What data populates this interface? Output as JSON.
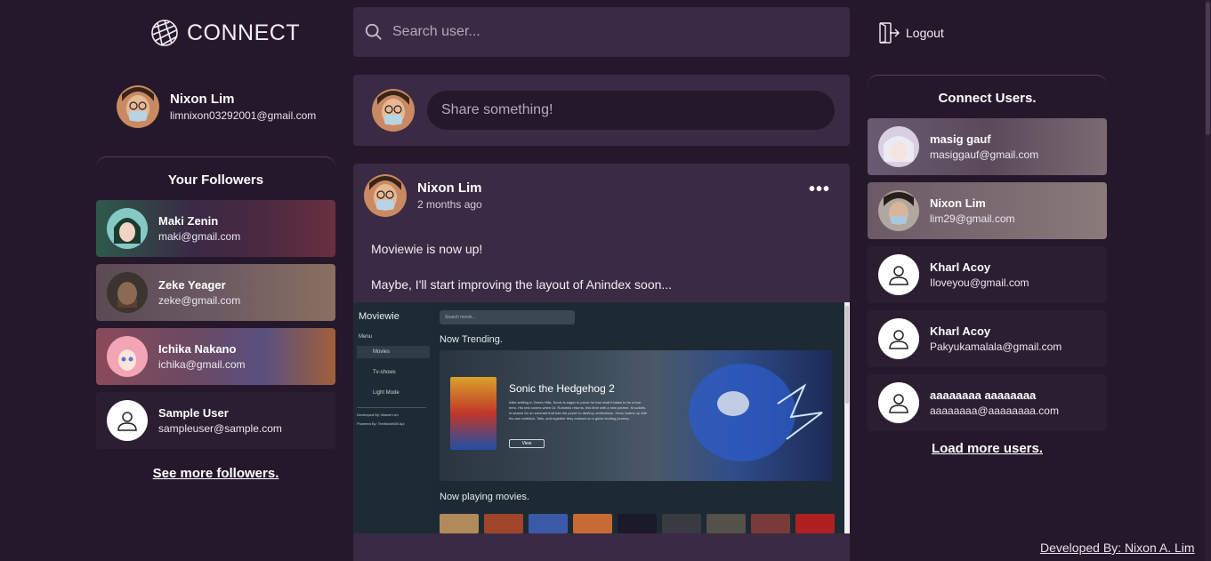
{
  "app": {
    "title": "CONNECT"
  },
  "header": {
    "search_placeholder": "Search user...",
    "logout_label": "Logout"
  },
  "me": {
    "name": "Nixon Lim",
    "email": "limnixon03292001@gmail.com"
  },
  "followers": {
    "title": "Your Followers",
    "items": [
      {
        "name": "Maki Zenin",
        "email": "maki@gmail.com"
      },
      {
        "name": "Zeke Yeager",
        "email": "zeke@gmail.com"
      },
      {
        "name": "Ichika Nakano",
        "email": "ichika@gmail.com"
      },
      {
        "name": "Sample User",
        "email": "sampleuser@sample.com"
      }
    ],
    "see_more_label": "See more followers."
  },
  "share": {
    "placeholder": "Share something!"
  },
  "post": {
    "author": "Nixon Lim",
    "time": "2 months ago",
    "menu_glyph": "•••",
    "lines": [
      "Moviewie is now up!",
      "Maybe, I'll start improving the layout of Anindex soon..."
    ],
    "image": {
      "app_name": "Moviewie",
      "menu_heading": "Menu",
      "menu_items": [
        "Movies",
        "Tv-shows",
        "Light Mode"
      ],
      "footer_lines": [
        "Developed By: Marcel Lim",
        "Powered By: TheMovieDB Api"
      ],
      "search_placeholder": "Search movie...",
      "trending_label": "Now Trending.",
      "featured_title": "Sonic the Hedgehog 2",
      "featured_desc": "After settling in Green Hills, Sonic is eager to prove he has what it takes to be a true hero. His test comes when Dr. Robotnik returns, this time with a new partner, Knuckles, in search for an emerald that has the power to destroy civilizations. Sonic teams up with his own sidekick, Tails, and together they embark on a globe-trotting journey...",
      "view_label": "View",
      "now_playing_label": "Now playing movies."
    }
  },
  "connect": {
    "title": "Connect Users.",
    "items": [
      {
        "name": "masig gauf",
        "email": "masiggauf@gmail.com"
      },
      {
        "name": "Nixon Lim",
        "email": "lim29@gmail.com"
      },
      {
        "name": "Kharl Acoy",
        "email": "Iloveyou@gmail.com"
      },
      {
        "name": "Kharl Acoy",
        "email": "Pakyukamalala@gmail.com"
      },
      {
        "name": "aaaaaaaa aaaaaaaa",
        "email": "aaaaaaaa@aaaaaaaa.com"
      }
    ],
    "load_more_label": "Load more users."
  },
  "footer": {
    "credits": "Developed By: Nixon A. Lim"
  },
  "colors": {
    "background": "#26182b",
    "panel": "#3b2a43",
    "accent": "#5b3a66"
  }
}
